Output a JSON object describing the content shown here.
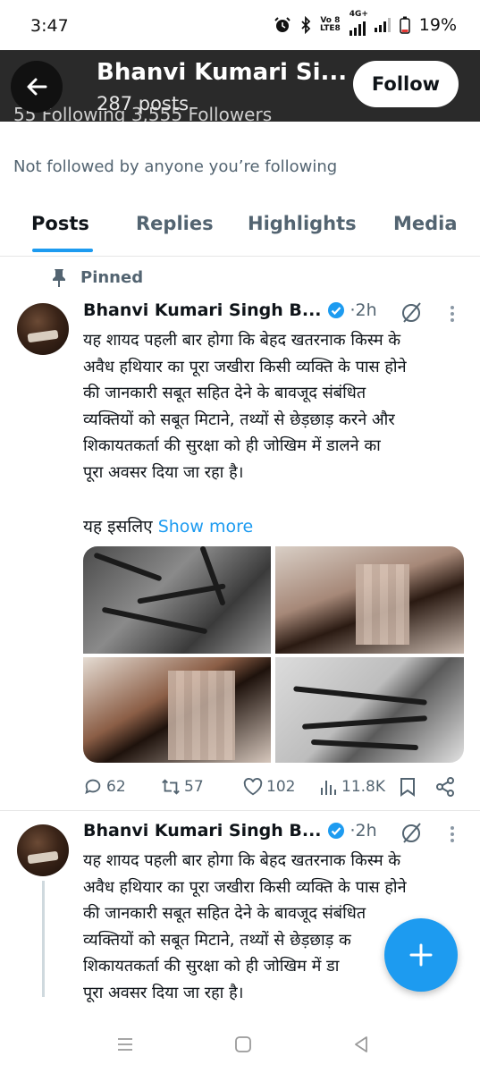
{
  "status_bar": {
    "time": "3:47",
    "net_top": "Vo 8",
    "net_bottom": "LTE8",
    "net_4g": "4G+",
    "battery": "19%"
  },
  "header": {
    "title": "Bhanvi Kumari Si...",
    "posts": "287 posts",
    "follow_label": "Follow",
    "behind_text": "55 Following   3,555 Followers"
  },
  "profile": {
    "not_followed": "Not followed by anyone you’re following"
  },
  "tabs": [
    "Posts",
    "Replies",
    "Highlights",
    "Media"
  ],
  "pinned_label": "Pinned",
  "tweets": [
    {
      "name": "Bhanvi Kumari Singh B...",
      "time": "·2h",
      "text_lines": [
        "यह शायद पहली बार होगा कि बेहद खतरनाक किस्म के",
        "अवैध हथियार का पूरा जखीरा किसी व्यक्ति के पास होने",
        "की जानकारी सबूत सहित देने के बावजूद संबंधित",
        "व्यक्तियों को सबूत मिटाने, तथ्यों से छेड़छाड़ करने और",
        "शिकायतकर्ता की सुरक्षा को ही जोखिम में डालने का",
        "पूरा अवसर दिया जा रहा है।"
      ],
      "more_prefix": "यह इसलिए",
      "show_more": "Show more",
      "replies": "62",
      "reposts": "57",
      "likes": "102",
      "views": "11.8K"
    },
    {
      "name": "Bhanvi Kumari Singh B...",
      "time": "·2h",
      "text_lines": [
        "यह शायद पहली बार होगा कि बेहद खतरनाक किस्म के",
        "अवैध हथियार का पूरा जखीरा किसी व्यक्ति के पास होने",
        "की जानकारी सबूत सहित देने के बावजूद संबंधित",
        "व्यक्तियों को सबूत मिटाने, तथ्यों से छेड़छाड़ क",
        "शिकायतकर्ता की सुरक्षा को ही जोखिम में डा",
        "पूरा अवसर दिया जा रहा है।"
      ]
    }
  ],
  "colors": {
    "accent": "#1d9bf0",
    "header_bg": "#2a2a2a",
    "muted": "#536471"
  },
  "icons": [
    "back-arrow-icon",
    "pin-icon",
    "verified-badge-icon",
    "grok-icon",
    "more-vertical-icon",
    "reply-icon",
    "repost-icon",
    "like-icon",
    "views-icon",
    "bookmark-icon",
    "share-icon",
    "compose-plus-icon"
  ]
}
